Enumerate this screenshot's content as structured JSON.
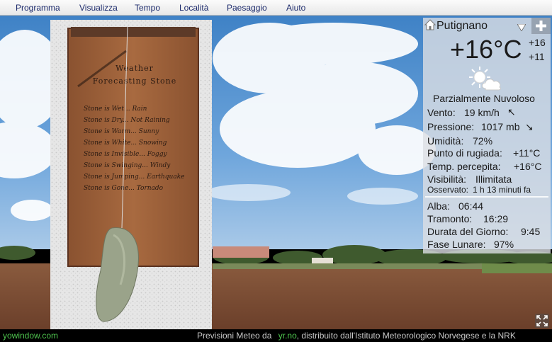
{
  "menu": {
    "items": [
      "Programma",
      "Visualizza",
      "Tempo",
      "Località",
      "Paesaggio",
      "Aiuto"
    ]
  },
  "sign": {
    "title_line1": "Weather",
    "title_line2": "Forecasting Stone",
    "lines": [
      "Stone is Wet... Rain",
      "Stone is Dry... Not Raining",
      "Stone is Warm... Sunny",
      "Stone is White... Snowing",
      "Stone is Invisible... Foggy",
      "Stone is Swinging... Windy",
      "Stone is Jumping... Earthquake",
      "Stone is Gone... Tornado"
    ]
  },
  "weather": {
    "location": "Putignano",
    "temperature": "+16°C",
    "temp_high": "+16",
    "temp_low": "+11",
    "condition": "Parzialmente Nuvoloso",
    "wind_label": "Vento:",
    "wind_value": "19 km/h",
    "wind_arrow": "↖",
    "pressure_label": "Pressione:",
    "pressure_value": "1017 mb",
    "pressure_arrow": "↘",
    "humidity_label": "Umidità:",
    "humidity_value": "72%",
    "dew_label": "Punto di rugiada:",
    "dew_value": "+11°C",
    "feels_label": "Temp. percepita:",
    "feels_value": "+16°C",
    "visibility_label": "Visibilità:",
    "visibility_value": "Illimitata",
    "observed_label": "Osservato:",
    "observed_value": "1 h 13 minuti fa",
    "sunrise_label": "Alba:",
    "sunrise_value": "06:44",
    "sunset_label": "Tramonto:",
    "sunset_value": "16:29",
    "daylength_label": "Durata del Giorno:",
    "daylength_value": "9:45",
    "moon_label": "Fase Lunare:",
    "moon_value": "97%"
  },
  "icons": {
    "home": "home-icon",
    "dropdown": "dropdown-triangle-icon",
    "add": "plus-icon",
    "weather": "partly-cloudy-icon",
    "fullscreen": "fullscreen-icon"
  },
  "footer": {
    "brand": "yowindow.com",
    "credit_prefix": "Previsioni Meteo da ",
    "credit_link": "yr.no",
    "credit_suffix": ", distribuito dall'Istituto Meteorologico Norvegese e la NRK"
  },
  "colors": {
    "menu_text": "#1c2a6b",
    "footer_green": "#4fc64f",
    "panel_bg": "#dcdfe4"
  }
}
